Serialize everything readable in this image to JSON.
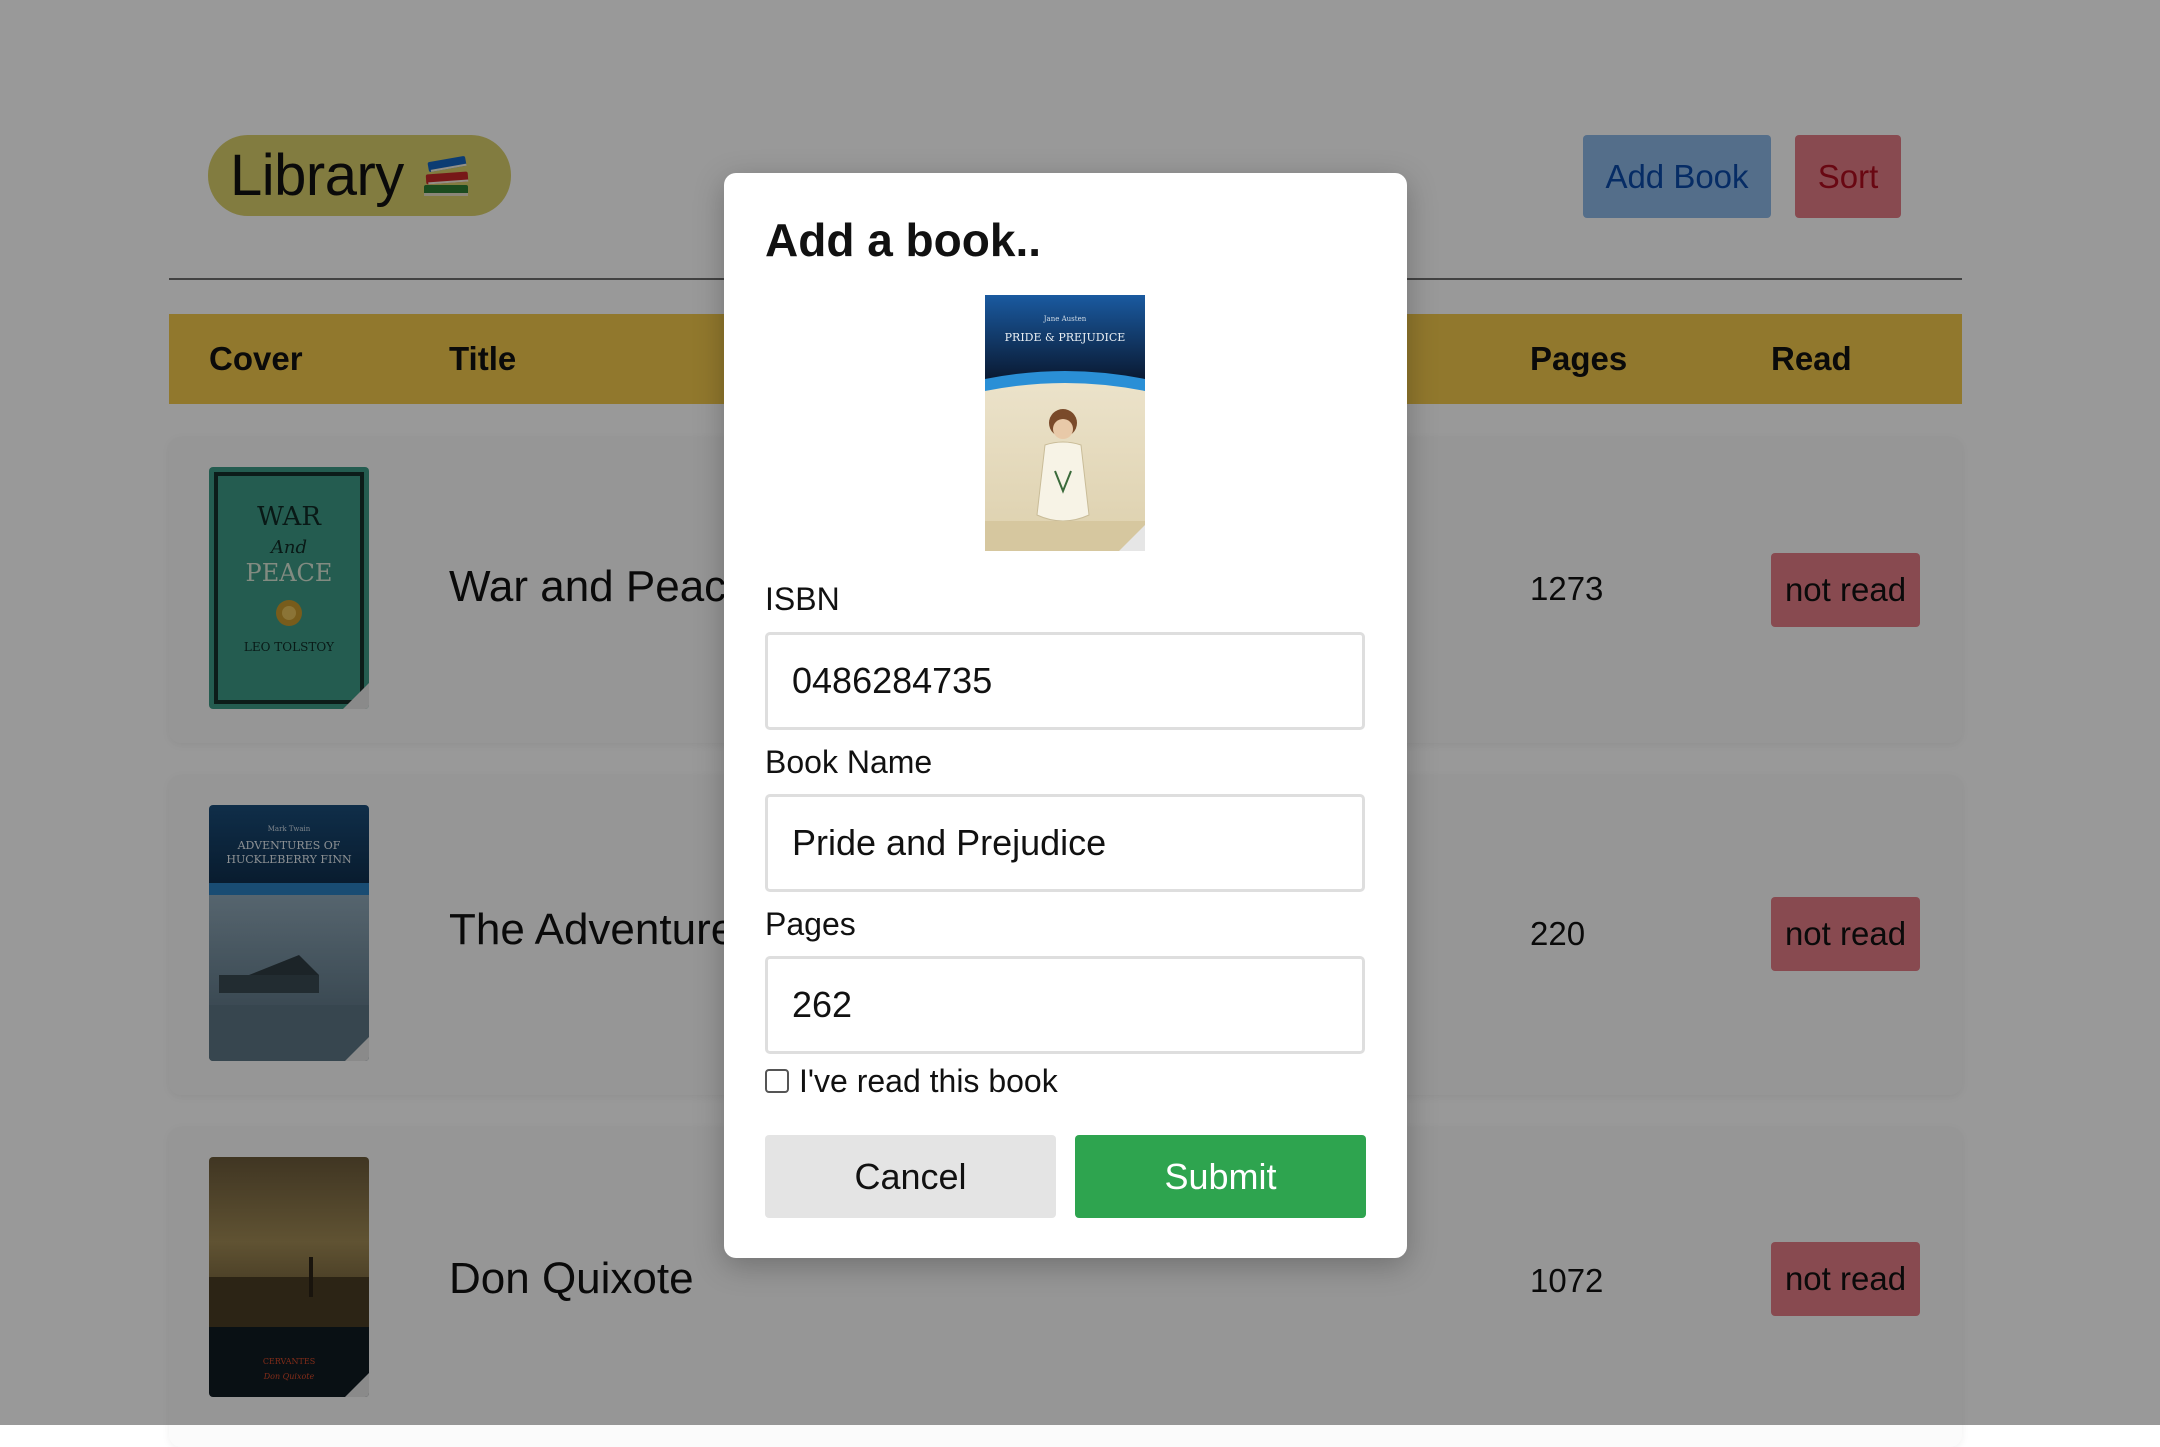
{
  "header": {
    "logo_text": "Library",
    "logo_icon": "books-icon",
    "add_book_label": "Add Book",
    "sort_label": "Sort"
  },
  "table": {
    "columns": [
      "Cover",
      "Title",
      "Pages",
      "Read"
    ],
    "rows": [
      {
        "title": "War and Peace",
        "pages": "1273",
        "read_status": "not read",
        "cover_icon": "war-and-peace-cover"
      },
      {
        "title": "The Adventures of Huckleberry Finn",
        "pages": "220",
        "read_status": "not read",
        "cover_icon": "huckleberry-finn-cover"
      },
      {
        "title": "Don Quixote",
        "pages": "1072",
        "read_status": "not read",
        "cover_icon": "don-quixote-cover"
      }
    ]
  },
  "modal": {
    "title": "Add a book..",
    "cover_icon": "pride-and-prejudice-cover",
    "isbn_label": "ISBN",
    "isbn_value": "0486284735",
    "name_label": "Book Name",
    "name_value": "Pride and Prejudice",
    "pages_label": "Pages",
    "pages_value": "262",
    "read_checkbox_label": "I've read this book",
    "read_checked": false,
    "cancel_label": "Cancel",
    "submit_label": "Submit"
  },
  "colors": {
    "logo_bg": "#d9cf6b",
    "add_book_bg": "#8cb7e6",
    "sort_bg": "#e37c85",
    "table_header_bg": "#f2c94c",
    "not_read_bg": "#e37c85",
    "submit_bg": "#2ea44f",
    "cancel_bg": "#e4e4e4"
  }
}
